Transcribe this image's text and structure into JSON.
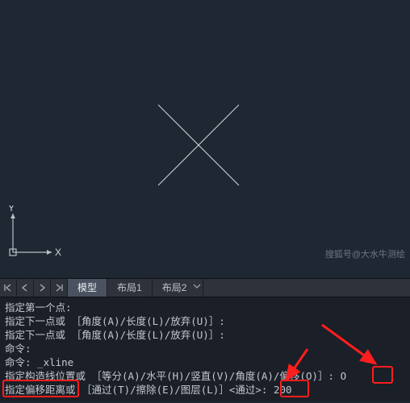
{
  "ucs": {
    "x_label": "X",
    "y_label": "Y"
  },
  "tabs": {
    "model": "模型",
    "layout1": "布局1",
    "layout2": "布局2"
  },
  "cmd": {
    "line1": "指定第一个点:",
    "line2": "指定下一点或 ［角度(A)/长度(L)/放弃(U)］:",
    "line3": "指定下一点或 ［角度(A)/长度(L)/放弃(U)］:",
    "line4": "命令:",
    "line5": "命令:  _xline",
    "line6_a": "指定构造线位置或 ［等分(A)/水平(H)/竖直(V)/角度(A)/偏移(O)］: ",
    "line6_val": "O",
    "line7_a": "指定偏移距离",
    "line7_b": "或 ［通过(T)/擦除(E)/图层(L)］<通过>: ",
    "line7_val": "200"
  },
  "watermark": "搜狐号@大水牛测绘"
}
